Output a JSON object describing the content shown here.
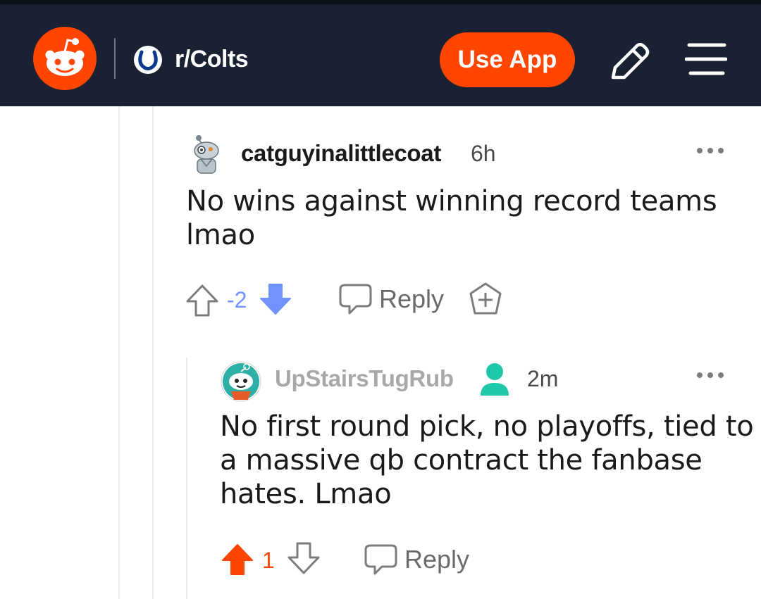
{
  "header": {
    "subreddit": "r/Colts",
    "use_app_label": "Use App"
  },
  "comments": [
    {
      "author": "catguyinalittlecoat",
      "time": "6h",
      "body": [
        "No wins against winning record teams",
        "lmao"
      ],
      "score": "-2",
      "vote_state": "downvoted",
      "reply_label": "Reply"
    },
    {
      "author": "UpStairsTugRub",
      "time": "2m",
      "body": [
        "No first round pick, no playoffs, tied to",
        "a massive qb contract the fanbase",
        "hates. Lmao"
      ],
      "score": "1",
      "vote_state": "upvoted",
      "reply_label": "Reply"
    }
  ],
  "colors": {
    "header_bg": "#1a2132",
    "brand_orange": "#ff4500",
    "downvote_blue": "#7193ff",
    "op_badge_teal": "#1fc8a8"
  },
  "icons": [
    "reddit-logo",
    "colts-icon",
    "pencil-icon",
    "menu-icon",
    "more-icon",
    "upvote-icon",
    "downvote-icon",
    "reply-icon",
    "award-icon",
    "op-user-icon"
  ]
}
